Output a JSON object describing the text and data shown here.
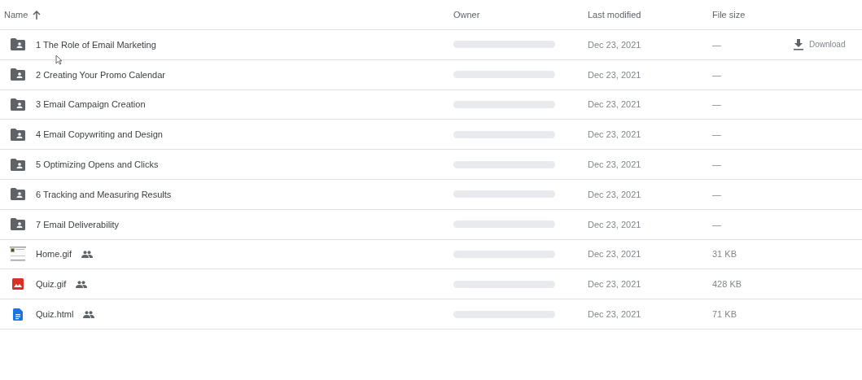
{
  "table": {
    "columns": [
      {
        "label": "Name",
        "sorted": true
      },
      {
        "label": "Owner",
        "sorted": false
      },
      {
        "label": "Last modified",
        "sorted": false
      },
      {
        "label": "File size",
        "sorted": false
      }
    ],
    "rows": [
      {
        "kind": "folder",
        "name": "1 The Role of Email Marketing",
        "shared": false,
        "modified": "Dec 23, 2021",
        "size": "—",
        "action": "Download"
      },
      {
        "kind": "folder",
        "name": "2 Creating Your Promo Calendar",
        "shared": false,
        "modified": "Dec 23, 2021",
        "size": "—"
      },
      {
        "kind": "folder",
        "name": "3 Email Campaign Creation",
        "shared": false,
        "modified": "Dec 23, 2021",
        "size": "—"
      },
      {
        "kind": "folder",
        "name": "4 Email Copywriting and Design",
        "shared": false,
        "modified": "Dec 23, 2021",
        "size": "—"
      },
      {
        "kind": "folder",
        "name": "5 Optimizing Opens and Clicks",
        "shared": false,
        "modified": "Dec 23, 2021",
        "size": "—"
      },
      {
        "kind": "folder",
        "name": "6 Tracking and Measuring Results",
        "shared": false,
        "modified": "Dec 23, 2021",
        "size": "—"
      },
      {
        "kind": "folder",
        "name": "7 Email Deliverability",
        "shared": false,
        "modified": "Dec 23, 2021",
        "size": "—"
      },
      {
        "kind": "thumbnail",
        "name": "Home.gif",
        "shared": true,
        "modified": "Dec 23, 2021",
        "size": "31 KB"
      },
      {
        "kind": "image",
        "name": "Quiz.gif",
        "shared": true,
        "modified": "Dec 23, 2021",
        "size": "428 KB"
      },
      {
        "kind": "document",
        "name": "Quiz.html",
        "shared": true,
        "modified": "Dec 23, 2021",
        "size": "71 KB"
      }
    ]
  }
}
